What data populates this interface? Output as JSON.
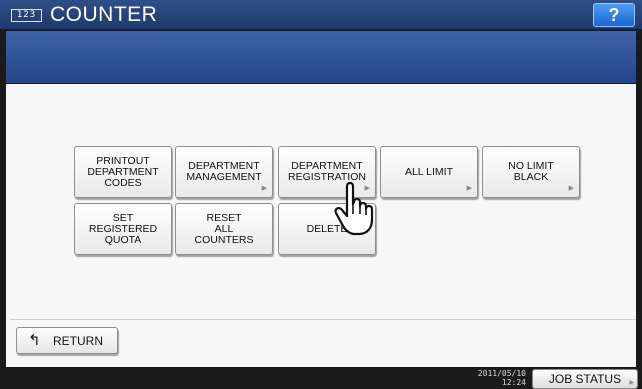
{
  "titlebar": {
    "icon_text": "123",
    "title": "COUNTER",
    "help_label": "?"
  },
  "menu_buttons": [
    {
      "label": "PRINTOUT\nDEPARTMENT\nCODES",
      "has_arrow": false
    },
    {
      "label": "DEPARTMENT\nMANAGEMENT",
      "has_arrow": true
    },
    {
      "label": "DEPARTMENT\nREGISTRATION",
      "has_arrow": true
    },
    {
      "label": "ALL LIMIT",
      "has_arrow": true
    },
    {
      "label": "NO LIMIT\nBLACK",
      "has_arrow": true
    },
    {
      "label": "SET\nREGISTERED\nQUOTA",
      "has_arrow": false
    },
    {
      "label": "RESET\nALL\nCOUNTERS",
      "has_arrow": false
    },
    {
      "label": "DELETE",
      "has_arrow": false
    }
  ],
  "return_label": "RETURN",
  "status": {
    "date": "2011/05/10",
    "time": "12:24",
    "job_status_label": "JOB STATUS"
  },
  "icons": {
    "app": "counter-123-icon",
    "return": "return-arrow-icon",
    "pointer": "hand-pointer-icon"
  }
}
